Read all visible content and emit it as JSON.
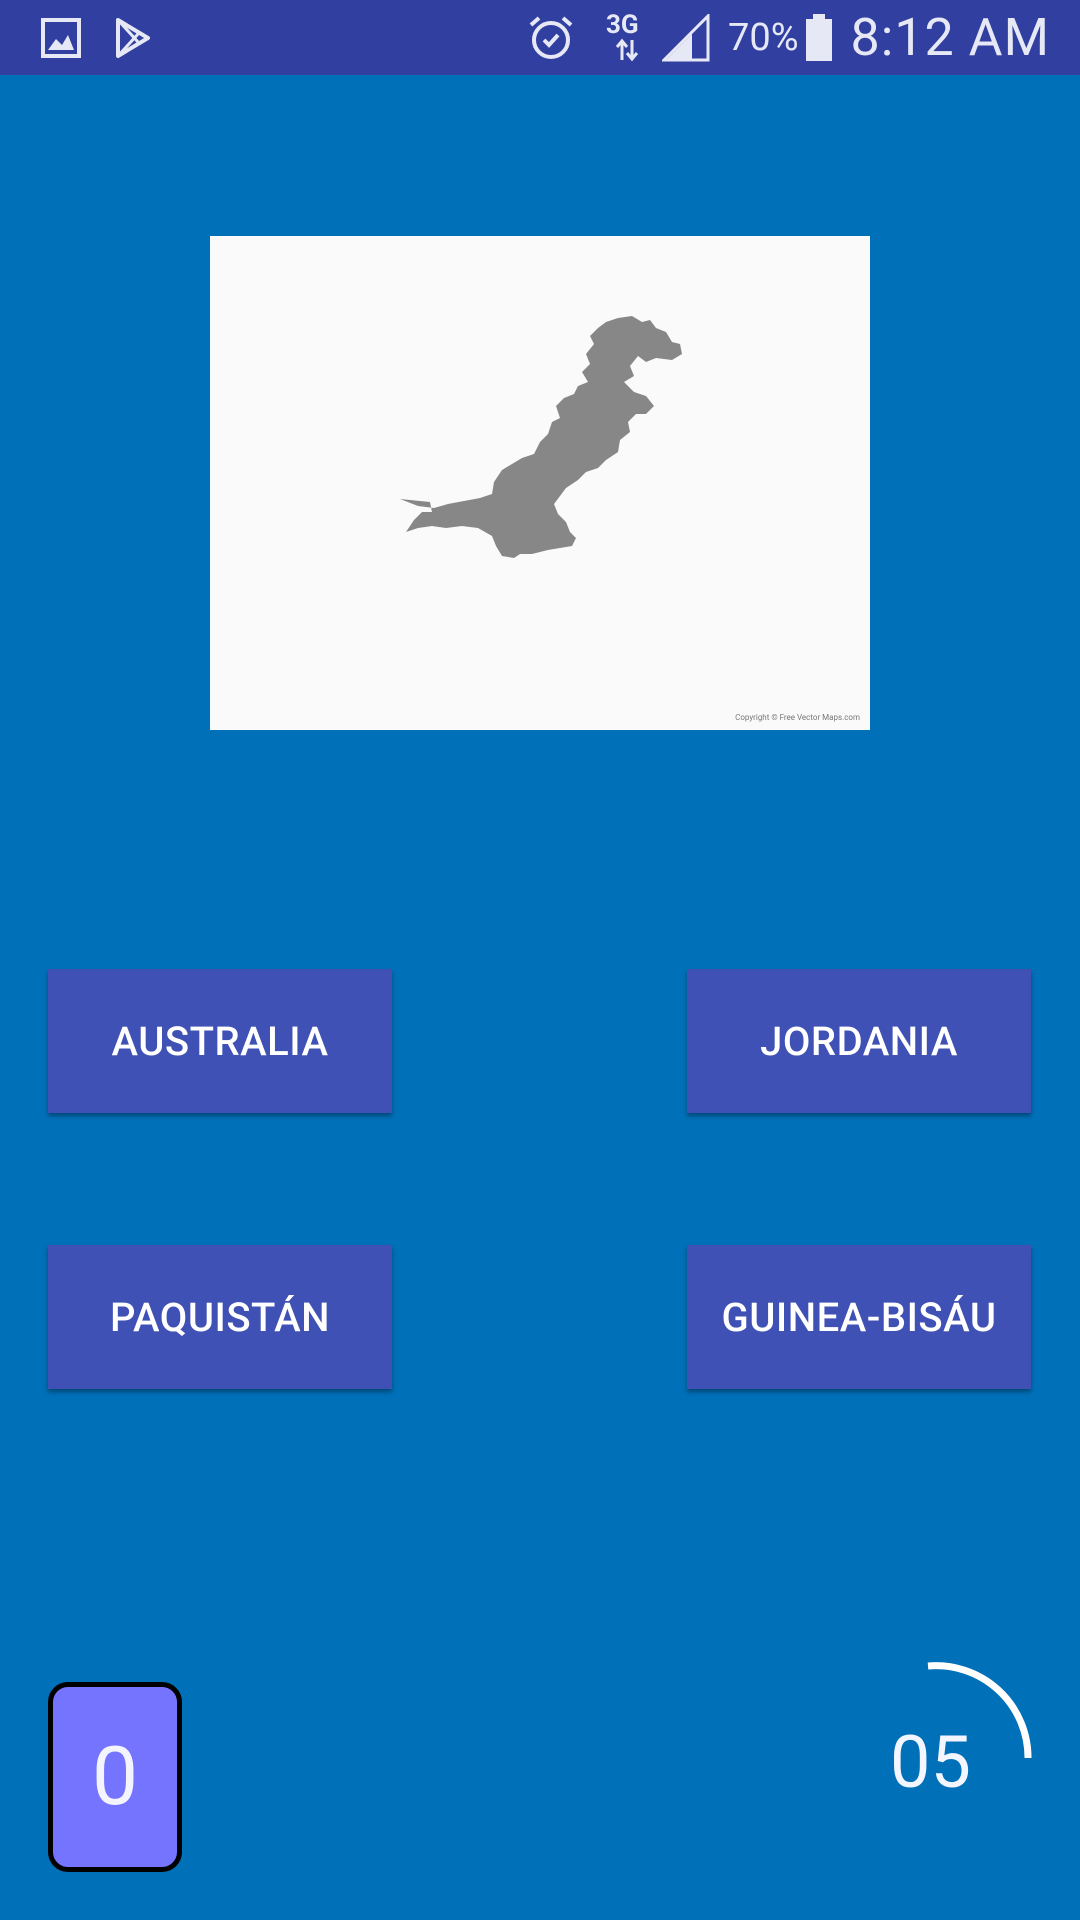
{
  "status_bar": {
    "network_label": "3G",
    "battery_percent": "70%",
    "time": "8:12 AM",
    "icons": [
      "gallery-icon",
      "play-store-icon",
      "alarm-icon",
      "data-arrows-icon",
      "signal-icon",
      "battery-icon"
    ]
  },
  "map": {
    "country_shape": "pakistan-silhouette",
    "copyright": "Copyright © Free Vector Maps.com"
  },
  "answers": [
    {
      "label": "AUSTRALIA"
    },
    {
      "label": "JORDANIA"
    },
    {
      "label": "PAQUISTÁN"
    },
    {
      "label": "GUINEA-BISÁU"
    }
  ],
  "score": {
    "value": "0"
  },
  "timer": {
    "value": "05"
  },
  "colors": {
    "background": "#0070B8",
    "status_bar": "#3140A0",
    "button": "#3F51B5",
    "score_box": "#7474FF",
    "map_fill": "#878787"
  }
}
